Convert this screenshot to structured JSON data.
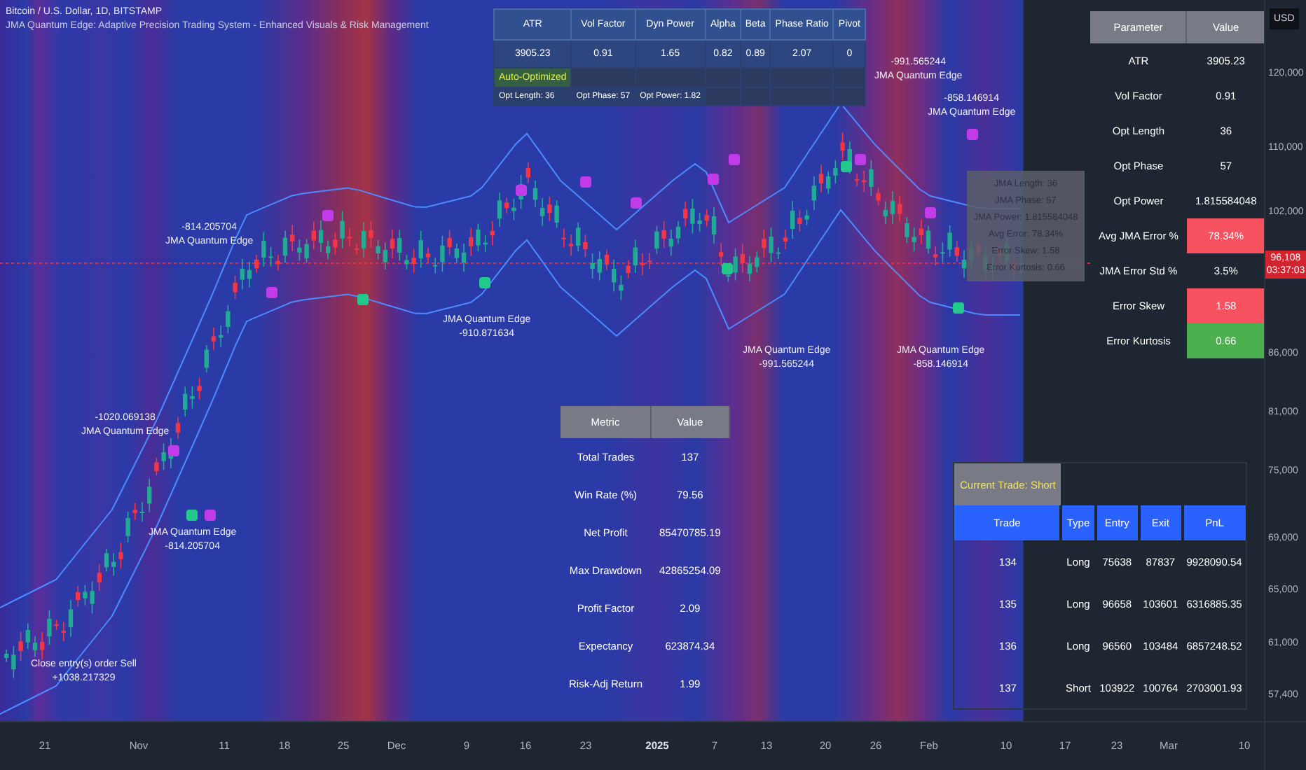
{
  "header": {
    "symbol": "Bitcoin / U.S. Dollar, 1D, BITSTAMP",
    "indicator": "JMA Quantum Edge: Adaptive Precision Trading System - Enhanced Visuals & Risk Management"
  },
  "stats_table": {
    "columns": [
      "ATR",
      "Vol Factor",
      "Dyn Power",
      "Alpha",
      "Beta",
      "Phase Ratio",
      "Pivot"
    ],
    "values": [
      "3905.23",
      "0.91",
      "1.65",
      "0.82",
      "0.89",
      "2.07",
      "0"
    ],
    "status": "Auto-Optimized",
    "settings": [
      "Opt Length: 36",
      "Opt Phase: 57",
      "Opt Power: 1.82"
    ]
  },
  "parameter_table": {
    "columns": [
      "Parameter",
      "Value"
    ],
    "rows": [
      {
        "name": "ATR",
        "value": "3905.23"
      },
      {
        "name": "Vol Factor",
        "value": "0.91"
      },
      {
        "name": "Opt Length",
        "value": "36"
      },
      {
        "name": "Opt Phase",
        "value": "57"
      },
      {
        "name": "Opt Power",
        "value": "1.815584048"
      },
      {
        "name": "Avg JMA Error %",
        "value": "78.34%",
        "color": "#f7525f"
      },
      {
        "name": "JMA Error Std %",
        "value": "3.5%"
      },
      {
        "name": "Error Skew",
        "value": "1.58",
        "color": "#f7525f"
      },
      {
        "name": "Error Kurtosis",
        "value": "0.66",
        "color": "#4caf50"
      }
    ]
  },
  "tooltip": {
    "lines": [
      "JMA Length: 36",
      "JMA Phase: 57",
      "JMA Power: 1.815584048",
      "Avg Error: 78.34%",
      "Error Skew: 1.58",
      "Error Kurtosis: 0.66"
    ]
  },
  "metrics_table": {
    "columns": [
      "Metric",
      "Value"
    ],
    "rows": [
      {
        "name": "Total Trades",
        "value": "137"
      },
      {
        "name": "Win Rate (%)",
        "value": "79.56"
      },
      {
        "name": "Net Profit",
        "value": "85470785.19"
      },
      {
        "name": "Max Drawdown",
        "value": "42865254.09"
      },
      {
        "name": "Profit Factor",
        "value": "2.09"
      },
      {
        "name": "Expectancy",
        "value": "623874.34"
      },
      {
        "name": "Risk-Adj Return",
        "value": "1.99"
      }
    ]
  },
  "trade_table": {
    "current": "Current Trade: Short",
    "columns": [
      "Trade",
      "Type",
      "Entry",
      "Exit",
      "PnL"
    ],
    "rows": [
      [
        "134",
        "Long",
        "75638",
        "87837",
        "9928090.54"
      ],
      [
        "135",
        "Long",
        "96658",
        "103601",
        "6316885.35"
      ],
      [
        "136",
        "Long",
        "96560",
        "103484",
        "6857248.52"
      ],
      [
        "137",
        "Short",
        "103922",
        "100764",
        "2703001.93"
      ]
    ]
  },
  "annotations": [
    {
      "lines": [
        "-1020.069138",
        "JMA Quantum Edge"
      ]
    },
    {
      "lines": [
        "-814.205704",
        "JMA Quantum Edge"
      ]
    },
    {
      "lines": [
        "JMA Quantum Edge",
        "-814.205704"
      ]
    },
    {
      "lines": [
        "JMA Quantum Edge",
        "-910.871634"
      ]
    },
    {
      "lines": [
        "-991.565244",
        "JMA Quantum Edge"
      ]
    },
    {
      "lines": [
        "-858.146914",
        "JMA Quantum Edge"
      ]
    },
    {
      "lines": [
        "JMA Quantum Edge",
        "-991.565244"
      ]
    },
    {
      "lines": [
        "JMA Quantum Edge",
        "-858.146914"
      ]
    },
    {
      "lines": [
        "Close entry(s) order Sell",
        "+1038.217329"
      ]
    }
  ],
  "price_axis": {
    "currency": "USD",
    "labels": [
      "120,000",
      "110,000",
      "102,000",
      "86,000",
      "81,000",
      "75,000",
      "69,000",
      "65,000",
      "61,000",
      "57,400"
    ],
    "last_price": "96,108",
    "countdown": "03:37:03"
  },
  "time_axis": {
    "labels": [
      {
        "text": "21",
        "bold": false
      },
      {
        "text": "Nov",
        "bold": false
      },
      {
        "text": "11",
        "bold": false
      },
      {
        "text": "18",
        "bold": false
      },
      {
        "text": "25",
        "bold": false
      },
      {
        "text": "Dec",
        "bold": false
      },
      {
        "text": "9",
        "bold": false
      },
      {
        "text": "16",
        "bold": false
      },
      {
        "text": "23",
        "bold": false
      },
      {
        "text": "2025",
        "bold": true
      },
      {
        "text": "7",
        "bold": false
      },
      {
        "text": "13",
        "bold": false
      },
      {
        "text": "20",
        "bold": false
      },
      {
        "text": "26",
        "bold": false
      },
      {
        "text": "Feb",
        "bold": false
      },
      {
        "text": "10",
        "bold": false
      },
      {
        "text": "17",
        "bold": false
      },
      {
        "text": "23",
        "bold": false
      },
      {
        "text": "Mar",
        "bold": false
      },
      {
        "text": "10",
        "bold": false
      }
    ]
  }
}
